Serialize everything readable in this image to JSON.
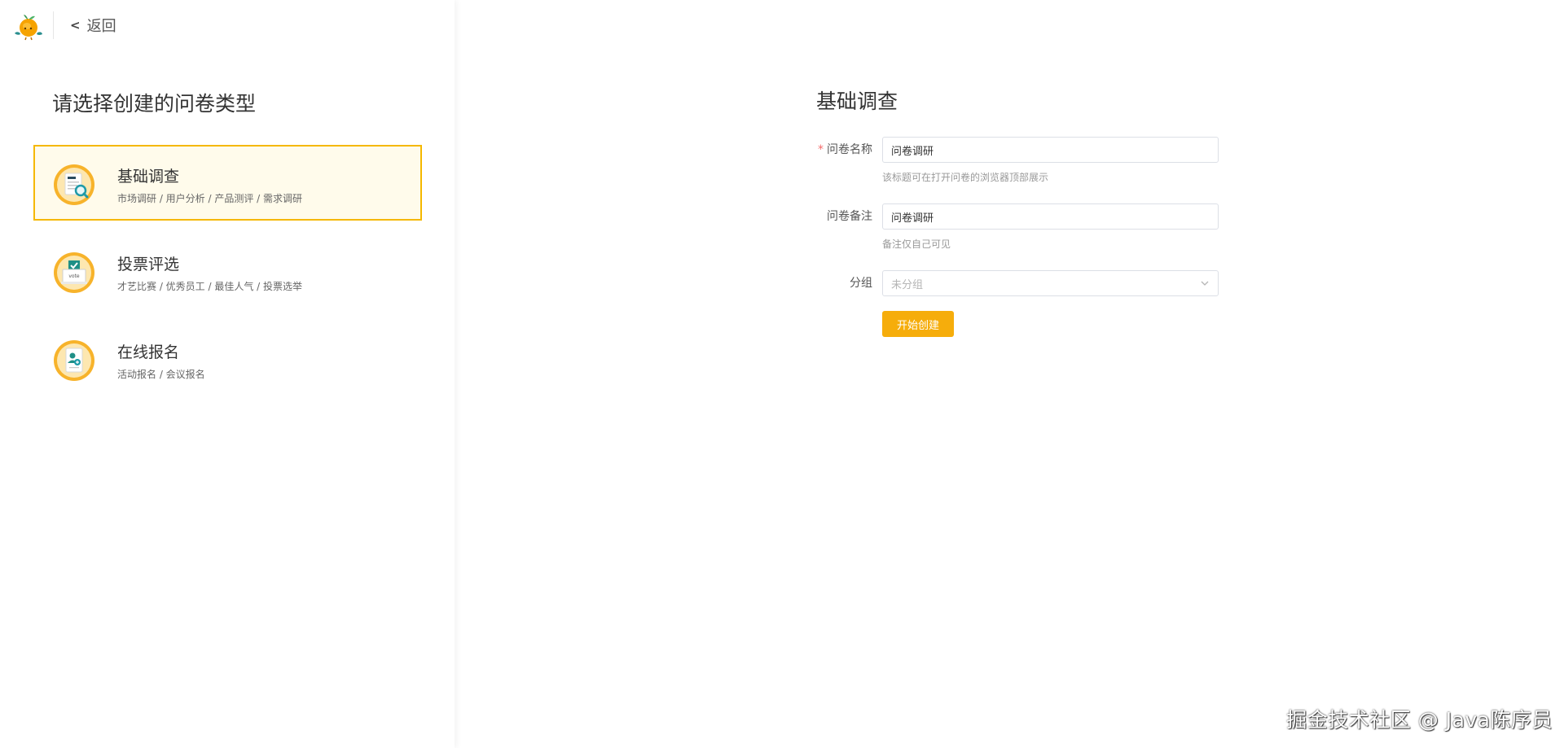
{
  "header": {
    "logo_icon": "orange-mascot-logo",
    "back_icon": "chevron-left-icon",
    "back_label": "返回"
  },
  "sidebar": {
    "title": "请选择创建的问卷类型",
    "types": [
      {
        "name": "基础调查",
        "desc": "市场调研 / 用户分析 / 产品测评 / 需求调研",
        "icon": "survey-search-icon",
        "selected": true
      },
      {
        "name": "投票评选",
        "desc": "才艺比赛 / 优秀员工 / 最佳人气 / 投票选举",
        "icon": "vote-box-icon",
        "selected": false
      },
      {
        "name": "在线报名",
        "desc": "活动报名 / 会议报名",
        "icon": "signup-form-icon",
        "selected": false
      }
    ]
  },
  "form": {
    "title": "基础调查",
    "name_label": "问卷名称",
    "name_required_mark": "*",
    "name_value": "问卷调研",
    "name_hint": "该标题可在打开问卷的浏览器顶部展示",
    "remark_label": "问卷备注",
    "remark_value": "问卷调研",
    "remark_hint": "备注仅自己可见",
    "group_label": "分组",
    "group_placeholder": "未分组",
    "submit_label": "开始创建"
  },
  "watermark": "掘金技术社区 @ Java陈序员",
  "colors": {
    "accent": "#f6ad0b",
    "selected_border": "#f5b800",
    "selected_bg": "#fffbeb",
    "required": "#f56c6c"
  }
}
